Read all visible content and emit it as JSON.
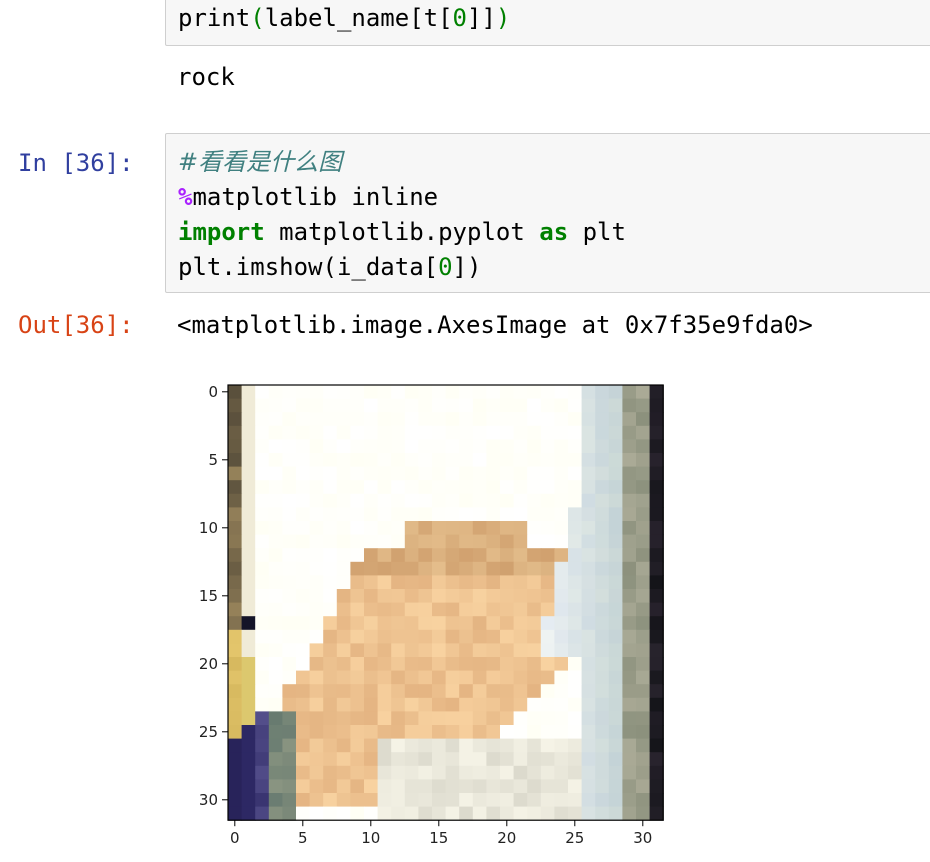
{
  "cell_prev": {
    "code": {
      "fn": "print",
      "open": "(",
      "arg": "label_name[t[",
      "idx": "0",
      "close_idx": "]]",
      "close": ")"
    },
    "output": "rock"
  },
  "cell_36": {
    "in_prompt": "In [36]:",
    "line1_comment": "#看看是什么图",
    "line2_magic": "%",
    "line2_rest": "matplotlib inline",
    "line3_kw1": "import",
    "line3_mid": " matplotlib.pyplot ",
    "line3_kw2": "as",
    "line3_rest": " plt",
    "line4_a": "plt.imshow(i_data[",
    "line4_idx": "0",
    "line4_b": "])",
    "out_prompt": "Out[36]:",
    "out_text": "<matplotlib.image.AxesImage at 0x7f35e9fda0>"
  },
  "chart_data": {
    "type": "heatmap",
    "title": "",
    "xlabel": "",
    "ylabel": "",
    "xlim": [
      -0.5,
      31.5
    ],
    "ylim": [
      31.5,
      -0.5
    ],
    "x_ticks": [
      "0",
      "5",
      "10",
      "15",
      "20",
      "25",
      "30"
    ],
    "y_ticks": [
      "0",
      "5",
      "10",
      "15",
      "20",
      "25",
      "30"
    ],
    "grid": false,
    "content": "32x32 RGB image: pale hand (rock gesture) on white/light-blue background"
  }
}
